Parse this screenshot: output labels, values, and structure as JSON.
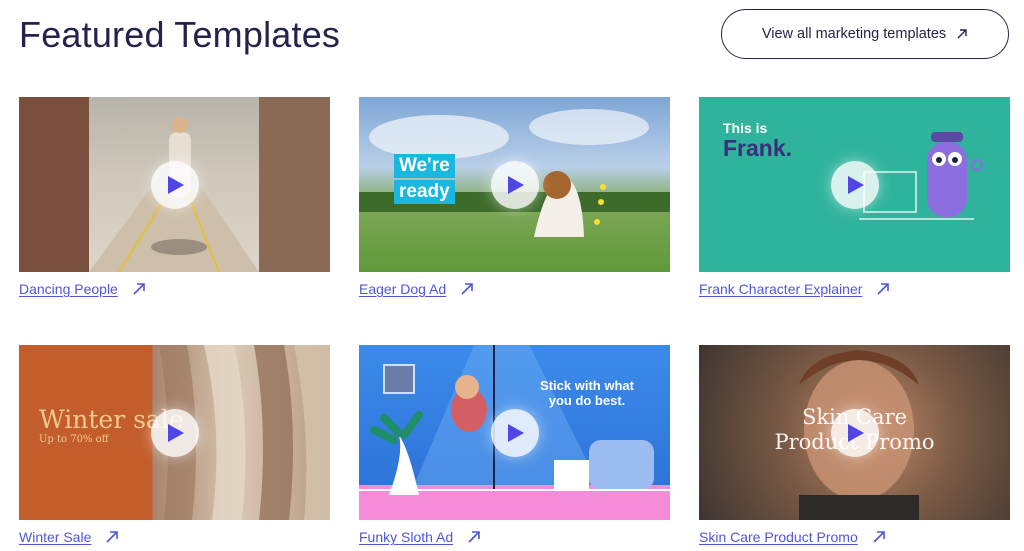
{
  "header": {
    "title": "Featured Templates",
    "view_all_label": "View all marketing templates"
  },
  "templates": [
    {
      "label": "Dancing People"
    },
    {
      "label": "Eager Dog Ad",
      "overlay": [
        "We're",
        "ready"
      ]
    },
    {
      "label": "Frank Character Explainer",
      "overlay": [
        "This is",
        "Frank."
      ]
    },
    {
      "label": "Winter Sale",
      "overlay": [
        "Winter sale",
        "Up to 70% off"
      ]
    },
    {
      "label": "Funky Sloth Ad",
      "overlay": [
        "Stick with what",
        "you do best."
      ]
    },
    {
      "label": "Skin Care Product Promo",
      "overlay": [
        "Skin Care",
        "Product Promo"
      ]
    }
  ],
  "colors": {
    "link": "#4f57d6",
    "heading": "#23244a",
    "play_triangle": "#4f46e5"
  },
  "icons": {
    "external": "arrow-up-right-icon",
    "play": "play-icon"
  }
}
